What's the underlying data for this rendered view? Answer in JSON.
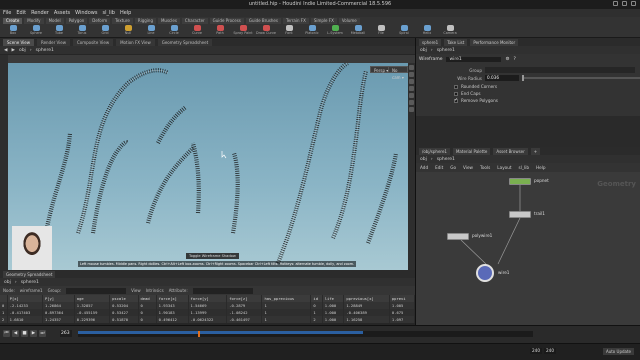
{
  "window": {
    "title": "untitled.hip - Houdini Indie Limited-Commercial 18.5.596"
  },
  "menubar": [
    "File",
    "Edit",
    "Render",
    "Assets",
    "Windows",
    "sl_lib",
    "Help"
  ],
  "shelf": {
    "tabs": [
      "Create",
      "Modify",
      "Model",
      "Polygon",
      "Deform",
      "Texture",
      "Rigging",
      "Muscles",
      "Character",
      "Guide Process",
      "Guide Brushes",
      "Terrain FX",
      "Simple FX",
      "Volume"
    ],
    "active_tab": "Create",
    "tools": [
      {
        "label": "Box",
        "color": "#6aa0d0"
      },
      {
        "label": "Sphere",
        "color": "#6aa0d0"
      },
      {
        "label": "Tube",
        "color": "#6aa0d0"
      },
      {
        "label": "Torus",
        "color": "#6aa0d0"
      },
      {
        "label": "Grid",
        "color": "#6aa0d0"
      },
      {
        "label": "Null",
        "color": "#cfa030"
      },
      {
        "label": "Line",
        "color": "#6aa0d0"
      },
      {
        "label": "Circle",
        "color": "#6aa0d0"
      },
      {
        "label": "Curve",
        "color": "#d05050"
      },
      {
        "label": "Path",
        "color": "#d05050"
      },
      {
        "label": "Spray Paint",
        "color": "#d05050"
      },
      {
        "label": "Draw Curve",
        "color": "#d05050"
      },
      {
        "label": "Font",
        "color": "#c0c0c0"
      },
      {
        "label": "Platonic",
        "color": "#6aa0d0"
      },
      {
        "label": "L-System",
        "color": "#50b050"
      },
      {
        "label": "Metaball",
        "color": "#6aa0d0"
      },
      {
        "label": "File",
        "color": "#c0c0c0"
      },
      {
        "label": "Spiral",
        "color": "#6aa0d0"
      },
      {
        "label": "Helix",
        "color": "#6aa0d0"
      },
      {
        "label": "Camera",
        "color": "#c0c0c0"
      }
    ]
  },
  "viewer": {
    "tabs": [
      "Scene View",
      "Render View",
      "Composite View",
      "Motion FX View",
      "Geometry Spreadsheet"
    ],
    "active_tab": "Scene View",
    "path": [
      "obj",
      "sphere1"
    ],
    "buttons": {
      "persp": "Persp ▾",
      "nocam": "No cam ▾"
    },
    "tooltip": "Toggle Wireframe Shadow",
    "status": "Left mouse tumbles. Middle pans. Right dollies. Ctrl+Alt+Left box-zooms. Ctrl+Right zooms. Spacebar Ctrl+Left tilts. Hotkeys: alternate tumble, dolly, and zoom."
  },
  "spreadsheet": {
    "tabs": [
      "Geometry Spreadsheet"
    ],
    "path": [
      "obj",
      "sphere1"
    ],
    "filter": {
      "node_label": "Node:",
      "node_value": "wireframe1",
      "group_label": "Group:",
      "view_label": "View",
      "intrinsics_label": "Intrinsics",
      "attribute_label": "Attribute:"
    },
    "columns": [
      "",
      "P[x]",
      "P[y]",
      "age",
      "pscale",
      "dead",
      "force[x]",
      "force[y]",
      "force[z]",
      "has_pprevious",
      "id",
      "life",
      "pprevious[x]",
      "pprevi"
    ],
    "rows": [
      [
        "0",
        "-2.14233",
        "1.26864",
        "1.32857",
        "0.53204",
        "0",
        "1.93343",
        "1.54669",
        "-0.2879",
        "1",
        "0",
        "1.000",
        "1.28849",
        "1.005"
      ],
      [
        "1",
        "-0.417403",
        "0.897364",
        "-0.455159",
        "0.53427",
        "0",
        "1.90183",
        "1.13999",
        "-1.08242",
        "1",
        "1",
        "1.000",
        "-0.406389",
        "0.675"
      ],
      [
        "2",
        "1.6810",
        "1.24357",
        "0.229396",
        "0.51870",
        "0",
        "0.496412",
        "-0.0624322",
        "-0.461497",
        "1",
        "2",
        "1.000",
        "1.16258",
        "1.097"
      ]
    ]
  },
  "timeline": {
    "frame": "263",
    "controls": [
      "⏮",
      "◀",
      "■",
      "▶",
      "⏭"
    ],
    "end_frame": "240",
    "end_frame2": "240",
    "keys": {
      "k1": "0 keys, 0/0 channels",
      "k2": "Key All Channels"
    },
    "auto_update": "Auto Update",
    "frame_start": "1",
    "frame_end": "1"
  },
  "params": {
    "tabs": [
      "sphere1",
      "Take List",
      "Performance Monitor"
    ],
    "path": [
      "obj",
      "sphere1"
    ],
    "node_type": "Wireframe",
    "node_name": "wire1",
    "group_label": "Group",
    "radius_label": "Wire Radius",
    "radius_value": "0.036",
    "checks": [
      {
        "label": "Rounded Corners",
        "on": false
      },
      {
        "label": "End Caps",
        "on": false
      },
      {
        "label": "Remove Polygons",
        "on": true
      }
    ]
  },
  "network": {
    "tabs": [
      "/obj/sphere1",
      "Material Palette",
      "Asset Browser",
      "+"
    ],
    "path": [
      "obj",
      "sphere1"
    ],
    "menu": [
      "Add",
      "Edit",
      "Go",
      "View",
      "Tools",
      "Layout",
      "sl_lib",
      "Help"
    ],
    "context_label": "Geometry",
    "nodes": [
      {
        "name": "popnet",
        "color": "#7ab050"
      },
      {
        "name": "trail1",
        "color": "#c8c8c8"
      },
      {
        "name": "polywire1",
        "color": "#c8c8c8"
      },
      {
        "name": "wire1",
        "color": "#5a6ab8"
      }
    ]
  },
  "colors": {
    "viewport_top": "#6a9ab0",
    "viewport_bottom": "#a8c9d3",
    "accent": "#e07020"
  }
}
